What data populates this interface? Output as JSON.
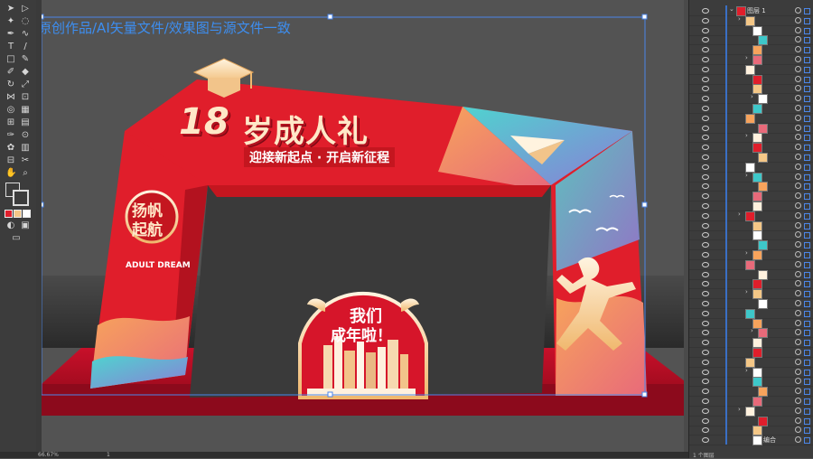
{
  "artboard": {
    "title": "原创作品/AI矢量文件/效果图与源文件一致"
  },
  "design": {
    "main_title_number": "18",
    "main_title_text": "岁成人礼",
    "subtitle": "迎接新起点 · 开启新征程",
    "badge_line1": "扬帆",
    "badge_line2": "起航",
    "badge_caption": "ADULT DREAM",
    "center_sign_line1": "我们",
    "center_sign_line2": "成年啦！"
  },
  "statusbar": {
    "zoom": "66.67%",
    "artboard_index": "1"
  },
  "layers_panel": {
    "top_layer_label": "图层 1",
    "bottom_item_label": "编合",
    "layer_count": "1 个图层",
    "rows": 45
  },
  "colors": {
    "red": "#e01e2b",
    "gold": "#f4c787",
    "teal": "#3ec7c9",
    "accent_blue": "#3d8ef0"
  }
}
